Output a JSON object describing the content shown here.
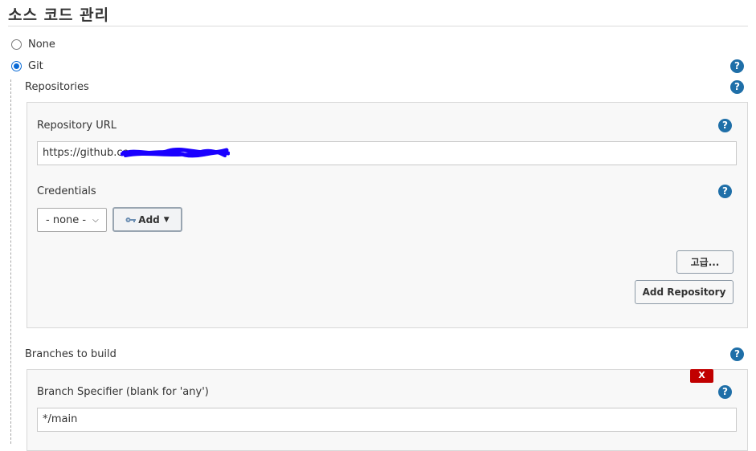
{
  "section": {
    "title": "소스 코드 관리"
  },
  "scm_options": [
    {
      "label": "None",
      "selected": false
    },
    {
      "label": "Git",
      "selected": true
    }
  ],
  "help_icon_glyph": "?",
  "repositories": {
    "heading": "Repositories",
    "url_label": "Repository URL",
    "url_value": "https://github.co",
    "url_redacted": true,
    "credentials_label": "Credentials",
    "credentials_selected": "- none -",
    "add_button_label": "Add",
    "add_button_icon": "key-icon",
    "advanced_button_label": "고급...",
    "add_repository_button_label": "Add Repository"
  },
  "branches": {
    "heading": "Branches to build",
    "delete_button_label": "X",
    "specifier_label": "Branch Specifier (blank for 'any')",
    "specifier_value": "*/main"
  },
  "colors": {
    "help_icon": "#1f6fa8",
    "radio_selected": "#0a6ad6",
    "delete_button": "#c10000",
    "redaction": "#1a00ff"
  }
}
